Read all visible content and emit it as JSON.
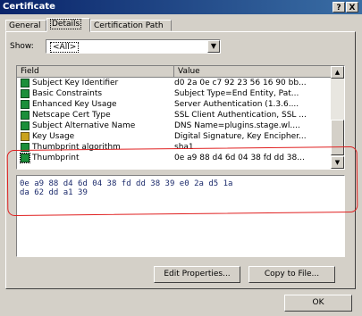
{
  "window": {
    "title": "Certificate",
    "help": "?",
    "close": "X"
  },
  "tabs": [
    {
      "label": "General"
    },
    {
      "label": "Details"
    },
    {
      "label": "Certification Path"
    }
  ],
  "show": {
    "label": "Show:",
    "value": "<All>"
  },
  "list": {
    "headers": {
      "field": "Field",
      "value": "Value"
    },
    "rows": [
      {
        "field": "Subject Key Identifier",
        "value": "d0 2a 0e c7 92 23 56 16 90 bb..."
      },
      {
        "field": "Basic Constraints",
        "value": "Subject Type=End Entity, Pat..."
      },
      {
        "field": "Enhanced Key Usage",
        "value": "Server Authentication (1.3.6...."
      },
      {
        "field": "Netscape Cert Type",
        "value": "SSL Client Authentication, SSL ..."
      },
      {
        "field": "Subject Alternative Name",
        "value": "DNS Name=plugins.stage.wl...."
      },
      {
        "field": "Key Usage",
        "value": "Digital Signature, Key Encipher..."
      },
      {
        "field": "Thumbprint algorithm",
        "value": "sha1"
      },
      {
        "field": "Thumbprint",
        "value": "0e a9 88 d4 6d 04 38 fd dd 38..."
      }
    ]
  },
  "detail": {
    "text": "0e a9 88 d4 6d 04 38 fd dd 38 39 e0 2a d5 1a\nda 62 dd a1 39"
  },
  "buttons": {
    "edit": "Edit Properties...",
    "copy": "Copy to File...",
    "ok": "OK"
  }
}
